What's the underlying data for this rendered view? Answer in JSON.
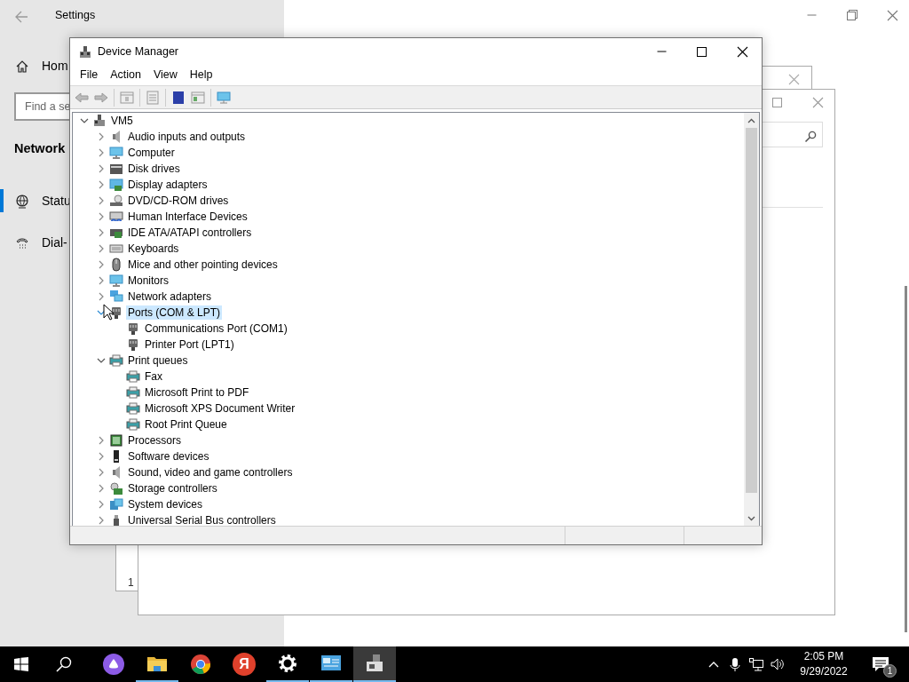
{
  "settings_window": {
    "title": "Settings",
    "home_label": "Hom",
    "search": {
      "placeholder": "Find a se"
    },
    "section_heading": "Network",
    "nav_items": [
      {
        "label": "Statu",
        "selected": true
      },
      {
        "label": "Dial-",
        "selected": false
      }
    ]
  },
  "back_window": {
    "footer_text": "1"
  },
  "device_manager": {
    "title": "Device Manager",
    "menu": [
      "File",
      "Action",
      "View",
      "Help"
    ],
    "tree": {
      "label": "VM5",
      "expanded": true,
      "selected": false,
      "children": [
        {
          "label": "Audio inputs and outputs",
          "expanded": false,
          "selected": false
        },
        {
          "label": "Computer",
          "expanded": false,
          "selected": false
        },
        {
          "label": "Disk drives",
          "expanded": false,
          "selected": false
        },
        {
          "label": "Display adapters",
          "expanded": false,
          "selected": false
        },
        {
          "label": "DVD/CD-ROM drives",
          "expanded": false,
          "selected": false
        },
        {
          "label": "Human Interface Devices",
          "expanded": false,
          "selected": false
        },
        {
          "label": "IDE ATA/ATAPI controllers",
          "expanded": false,
          "selected": false
        },
        {
          "label": "Keyboards",
          "expanded": false,
          "selected": false
        },
        {
          "label": "Mice and other pointing devices",
          "expanded": false,
          "selected": false
        },
        {
          "label": "Monitors",
          "expanded": false,
          "selected": false
        },
        {
          "label": "Network adapters",
          "expanded": false,
          "selected": false
        },
        {
          "label": "Ports (COM & LPT)",
          "expanded": true,
          "selected": true,
          "children": [
            {
              "label": "Communications Port (COM1)",
              "selected": false
            },
            {
              "label": "Printer Port (LPT1)",
              "selected": false
            }
          ]
        },
        {
          "label": "Print queues",
          "expanded": true,
          "selected": false,
          "children": [
            {
              "label": "Fax",
              "selected": false
            },
            {
              "label": "Microsoft Print to PDF",
              "selected": false
            },
            {
              "label": "Microsoft XPS Document Writer",
              "selected": false
            },
            {
              "label": "Root Print Queue",
              "selected": false
            }
          ]
        },
        {
          "label": "Processors",
          "expanded": false,
          "selected": false
        },
        {
          "label": "Software devices",
          "expanded": false,
          "selected": false
        },
        {
          "label": "Sound, video and game controllers",
          "expanded": false,
          "selected": false
        },
        {
          "label": "Storage controllers",
          "expanded": false,
          "selected": false
        },
        {
          "label": "System devices",
          "expanded": false,
          "selected": false
        },
        {
          "label": "Universal Serial Bus controllers",
          "expanded": false,
          "selected": false
        }
      ]
    }
  },
  "taskbar": {
    "apps": [
      {
        "kind": "assistant",
        "running": false,
        "selected": false
      },
      {
        "kind": "folder",
        "running": true,
        "selected": false
      },
      {
        "kind": "browser",
        "running": false,
        "selected": false
      },
      {
        "kind": "letter",
        "glyph": "Я",
        "running": false,
        "selected": false
      },
      {
        "kind": "gear",
        "running": true,
        "selected": false
      },
      {
        "kind": "control-panel",
        "running": true,
        "selected": false
      },
      {
        "kind": "device-manager",
        "running": true,
        "selected": true
      }
    ],
    "time": "2:05 PM",
    "date": "9/29/2022",
    "notification_count": "1"
  }
}
